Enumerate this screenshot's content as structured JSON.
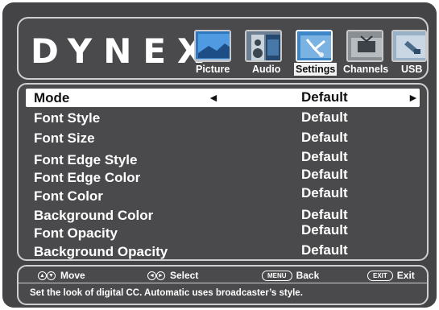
{
  "brand": {
    "logo_text": "DYNEX"
  },
  "tabs": [
    {
      "label": "Picture",
      "icon": "picture-icon",
      "selected": false
    },
    {
      "label": "Audio",
      "icon": "audio-icon",
      "selected": false
    },
    {
      "label": "Settings",
      "icon": "settings-icon",
      "selected": true
    },
    {
      "label": "Channels",
      "icon": "channels-icon",
      "selected": false
    },
    {
      "label": "USB",
      "icon": "usb-icon",
      "selected": false
    }
  ],
  "menu": {
    "items": [
      {
        "name": "Mode",
        "value": "Default",
        "selected": true,
        "left_arrow": "◄",
        "right_arrow": "►"
      },
      {
        "name": "Font Style",
        "value": "Default"
      },
      {
        "name": "Font Size",
        "value": "Default"
      },
      {
        "name": "Font Edge Style",
        "value": "Default"
      },
      {
        "name": "Font Edge Color",
        "value": "Default"
      },
      {
        "name": "Font Color",
        "value": "Default"
      },
      {
        "name": "Background Color",
        "value": "Default"
      },
      {
        "name": "Font Opacity",
        "value": "Default"
      },
      {
        "name": "Background Opacity",
        "value": "Default"
      }
    ]
  },
  "footer": {
    "hints": [
      {
        "key": "up-down-icon",
        "key_text": "▲▼",
        "label": "Move"
      },
      {
        "key": "left-right-icon",
        "key_text": "◄►",
        "label": "Select"
      },
      {
        "key": "menu-key",
        "key_text": "MENU",
        "label": "Back"
      },
      {
        "key": "exit-key",
        "key_text": "EXIT",
        "label": "Exit"
      }
    ],
    "help_text": "Set the look of digital CC. Automatic uses broadcaster’s style."
  },
  "colors": {
    "background": "#444446",
    "border": "#cfcfd2",
    "text": "#ffffff",
    "selected_row": "#ffffff",
    "thumb_blue": "#2d6fb3"
  }
}
